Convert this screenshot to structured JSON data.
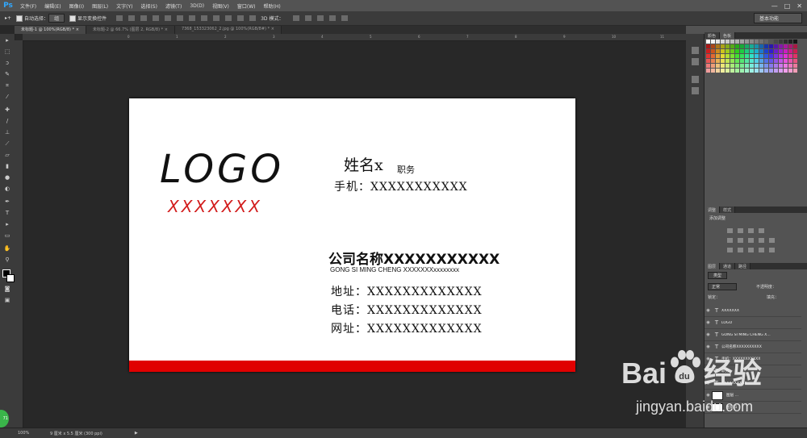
{
  "app": {
    "logo": "Ps"
  },
  "menu": [
    "文件(F)",
    "编辑(E)",
    "图像(I)",
    "图层(L)",
    "文字(Y)",
    "选择(S)",
    "滤镜(T)",
    "3D(D)",
    "视图(V)",
    "窗口(W)",
    "帮助(H)"
  ],
  "window_controls": [
    "—",
    "□",
    "✕"
  ],
  "options": {
    "auto_select_label": "自动选择：",
    "auto_select_value": "组",
    "show_transform_label": "显示变换控件",
    "mode_3d_label": "3D 模式：",
    "workspace": "基本功能"
  },
  "tabs": [
    {
      "label": "未标题-1 @ 100%(RGB/8) *",
      "close": "×"
    },
    {
      "label": "未标题-2 @ 66.7% (图层 2, RGB/8) *",
      "close": "×"
    },
    {
      "label": "7368_153323062_2.jpg @ 100%(RGB/8#) *",
      "close": "×"
    }
  ],
  "ruler_ticks": [
    "0",
    "1",
    "2",
    "3",
    "4",
    "5",
    "6",
    "7",
    "8",
    "9",
    "10",
    "11"
  ],
  "card": {
    "logo": "LOGO",
    "logo_sub": "XXXXXXX",
    "name": "姓名x",
    "title": "职务",
    "phone": "手机：XXXXXXXXXXX",
    "company": "公司名称XXXXXXXXXXX",
    "company_en": "GONG SI MING CHENG XXXXXXXxxxxxxxx",
    "address": "地址：XXXXXXXXXXXXX",
    "tel": "电话：XXXXXXXXXXXXX",
    "website": "网址：XXXXXXXXXXXXX"
  },
  "panels": {
    "color_tabs": [
      "颜色",
      "色板"
    ],
    "adj_tabs": [
      "调整",
      "样式"
    ],
    "adj_title": "添加调整",
    "layers_tabs": [
      "图层",
      "通道",
      "路径"
    ],
    "kind_label": "类型",
    "blend_mode": "正常",
    "opacity_label": "不透明度：",
    "lock_label": "锁定：",
    "fill_label": "填充："
  },
  "layers": [
    {
      "name": "XXXXXXX",
      "type": "T"
    },
    {
      "name": "LOGO",
      "type": "T"
    },
    {
      "name": "GONG SI MING CHENG X...",
      "type": "T"
    },
    {
      "name": "公司名称XXXXXXXXXX",
      "type": "T"
    },
    {
      "name": "手机：XXXXXXXXXXX",
      "type": "T"
    },
    {
      "name": "职务",
      "type": "T"
    },
    {
      "name": "XXXXXXXXXX",
      "type": "T"
    },
    {
      "name": "图层 ...",
      "type": "img"
    },
    {
      "name": "图层 1",
      "type": "img"
    }
  ],
  "status": {
    "zoom": "100%",
    "doc": "9 厘米 x 5.5 厘米 (300 ppi)",
    "arrow": "▶"
  },
  "watermark": {
    "brand_a": "Bai",
    "brand_b": "经验",
    "url": "jingyan.baidu.com"
  },
  "badge": "71",
  "colors": {
    "accent": "#31a8ff",
    "red_bar": "#e00000",
    "logo_sub": "#d21c1c"
  }
}
